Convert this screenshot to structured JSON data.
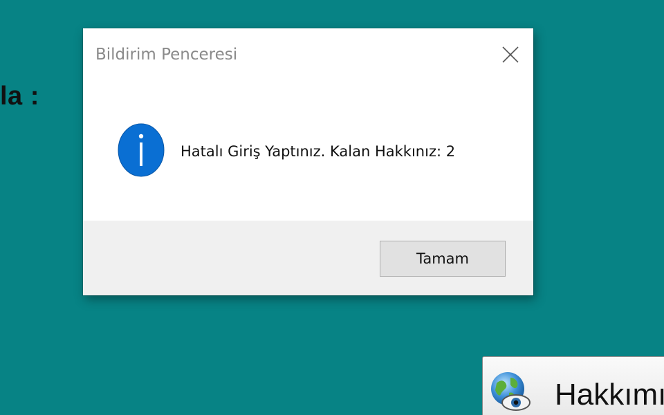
{
  "background": {
    "partial_label": "la :",
    "color": "#078385"
  },
  "dialog": {
    "title": "Bildirim Penceresi",
    "message": "Hatalı Giriş Yaptınız. Kalan Hakkınız: 2",
    "ok_label": "Tamam",
    "icon": "info-icon",
    "accent": "#0a6fd3"
  },
  "about_button": {
    "label": "Hakkımız",
    "icon": "globe-eye-icon"
  }
}
